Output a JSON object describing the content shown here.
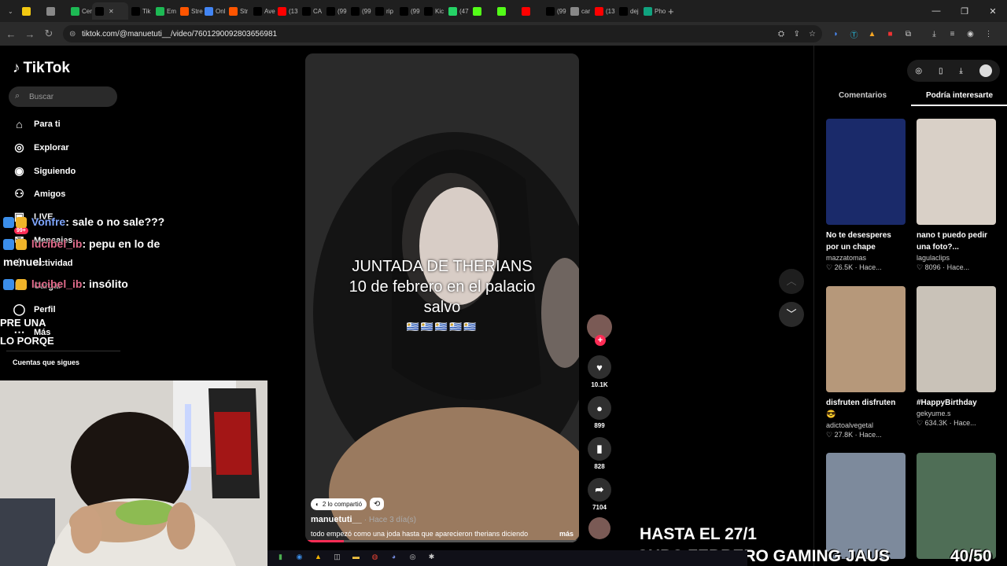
{
  "browser": {
    "tabs": [
      {
        "label": "",
        "color": "#f2c811"
      },
      {
        "label": "",
        "color": "#888888"
      },
      {
        "label": "Cer",
        "color": "#1db954"
      },
      {
        "label": "",
        "color": "#000000",
        "active": true
      },
      {
        "label": "Tik",
        "color": "#000000"
      },
      {
        "label": "Em",
        "color": "#1db954"
      },
      {
        "label": "Stre",
        "color": "#ff5500"
      },
      {
        "label": "Onl",
        "color": "#4285f4"
      },
      {
        "label": "Str",
        "color": "#ff5500"
      },
      {
        "label": "Ave",
        "color": "#000000"
      },
      {
        "label": "(13",
        "color": "#ff0000"
      },
      {
        "label": "CA",
        "color": "#000000"
      },
      {
        "label": "(99",
        "color": "#000000"
      },
      {
        "label": "(99",
        "color": "#000000"
      },
      {
        "label": "rip",
        "color": "#000000"
      },
      {
        "label": "(99",
        "color": "#000000"
      },
      {
        "label": "Kic",
        "color": "#000000"
      },
      {
        "label": "(47",
        "color": "#25d366"
      },
      {
        "label": "",
        "color": "#53fc18"
      },
      {
        "label": "",
        "color": "#53fc18"
      },
      {
        "label": "",
        "color": "#ff0000"
      },
      {
        "label": "(99",
        "color": "#000000"
      },
      {
        "label": "car",
        "color": "#888888"
      },
      {
        "label": "(13",
        "color": "#ff0000"
      },
      {
        "label": "dej",
        "color": "#000000"
      },
      {
        "label": "Pho",
        "color": "#10a37f"
      }
    ],
    "url": "tiktok.com/@manuetuti__/video/7601290092803656981"
  },
  "sidebar": {
    "logo": "TikTok",
    "search_placeholder": "Buscar",
    "items": [
      {
        "label": "Para ti",
        "icon": "home-icon"
      },
      {
        "label": "Explorar",
        "icon": "compass-icon"
      },
      {
        "label": "Siguiendo",
        "icon": "following-icon"
      },
      {
        "label": "Amigos",
        "icon": "friends-icon"
      },
      {
        "label": "LIVE",
        "icon": "live-icon"
      },
      {
        "label": "Mensajes",
        "icon": "messages-icon",
        "badge": "99+"
      },
      {
        "label": "Actividad",
        "icon": "activity-icon"
      },
      {
        "label": "Cargar",
        "icon": "upload-icon"
      },
      {
        "label": "Perfil",
        "icon": "profile-icon"
      },
      {
        "label": "Más",
        "icon": "more-icon"
      }
    ],
    "following_heading": "Cuentas que sigues"
  },
  "chat": {
    "line1_user": "Vonfre",
    "line1_msg": ": sale o no sale???",
    "line2_user": "lucibel_ib",
    "line2_msg": ": pepu en lo de",
    "line2_cont": "menuel",
    "line3_user": "lucibel_ib",
    "line3_msg": ": insólito",
    "frag1": "PRE UNA",
    "frag2": "LO PORQE"
  },
  "video": {
    "caption_line1": "JUNTADA DE THERIANS",
    "caption_line2": "10 de febrero en el palacio",
    "caption_line3": "salvo",
    "flags": "🇺🇾🇺🇾🇺🇾🇺🇾🇺🇾",
    "shared": "2 lo compartió",
    "author": "manuetuti__",
    "time": "· Hace 3 día(s)",
    "description": "todo empezó como una joda hasta que aparecieron therians diciendo",
    "more": "más",
    "progress": 0.14
  },
  "actions": {
    "likes": "10.1K",
    "comments": "899",
    "saves": "828",
    "shares": "7104"
  },
  "right_panel": {
    "tab_comments": "Comentarios",
    "tab_suggested": "Podría interesarte",
    "cards": [
      {
        "title": "No te desesperes por un chape",
        "user": "mazzatomas",
        "views": "26.5K",
        "time": "Hace...",
        "color": "#1a2a6a"
      },
      {
        "title": "nano t puedo pedir una foto?...",
        "user": "lagulaclips",
        "views": "8096",
        "time": "Hace...",
        "color": "#d9d0c7"
      },
      {
        "title": "disfruten disfruten 😎",
        "user": "adictoalvegetal",
        "views": "27.8K",
        "time": "Hace...",
        "color": "#b6987a"
      },
      {
        "title": "#HappyBirthday",
        "user": "gekyume.s",
        "views": "634.3K",
        "time": "Hace...",
        "color": "#c9c2b8"
      },
      {
        "title": "",
        "user": "",
        "views": "",
        "time": "",
        "color": "#7d8a9c"
      },
      {
        "title": "",
        "user": "",
        "views": "",
        "time": "",
        "color": "#4f6e56"
      }
    ]
  },
  "overlay": {
    "line1": "HASTA EL 27/1",
    "line2": "SUBS FEBRERO GAMING JAUS",
    "counter": "40/50"
  }
}
